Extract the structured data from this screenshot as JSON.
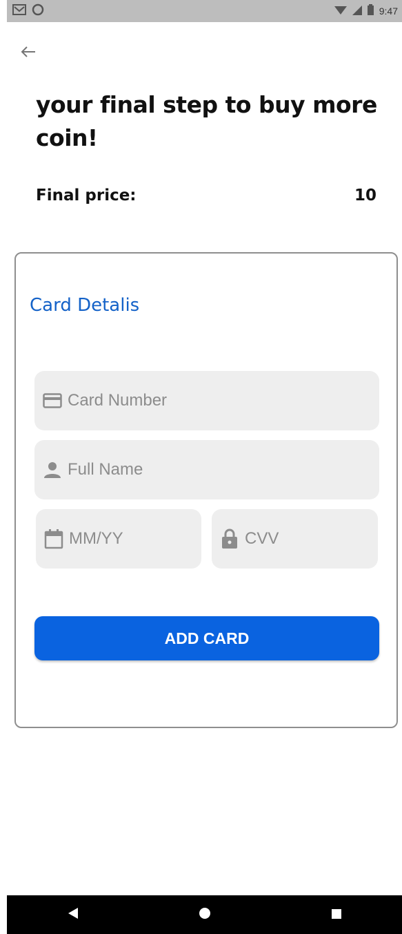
{
  "status_bar": {
    "time": "9:47",
    "icons_left": [
      "gmail-icon",
      "circle-notification-icon"
    ],
    "icons_right": [
      "wifi-icon",
      "signal-icon",
      "battery-icon"
    ]
  },
  "header": {
    "back_icon": "arrow-left-icon",
    "title": "your final step to buy more coin!"
  },
  "price": {
    "label": "Final price:",
    "value": "10"
  },
  "card_details": {
    "title": "Card Detalis",
    "card_number_placeholder": "Card Number",
    "full_name_placeholder": "Full Name",
    "expiry_placeholder": "MM/YY",
    "cvv_placeholder": "CVV",
    "add_button_label": "ADD CARD"
  },
  "colors": {
    "accent": "#1462c8",
    "button": "#0a63e0",
    "field_bg": "#eeeeee",
    "placeholder": "#8c8c8c"
  },
  "nav_bar": {
    "icons": [
      "back-triangle-icon",
      "home-circle-icon",
      "recents-square-icon"
    ]
  }
}
